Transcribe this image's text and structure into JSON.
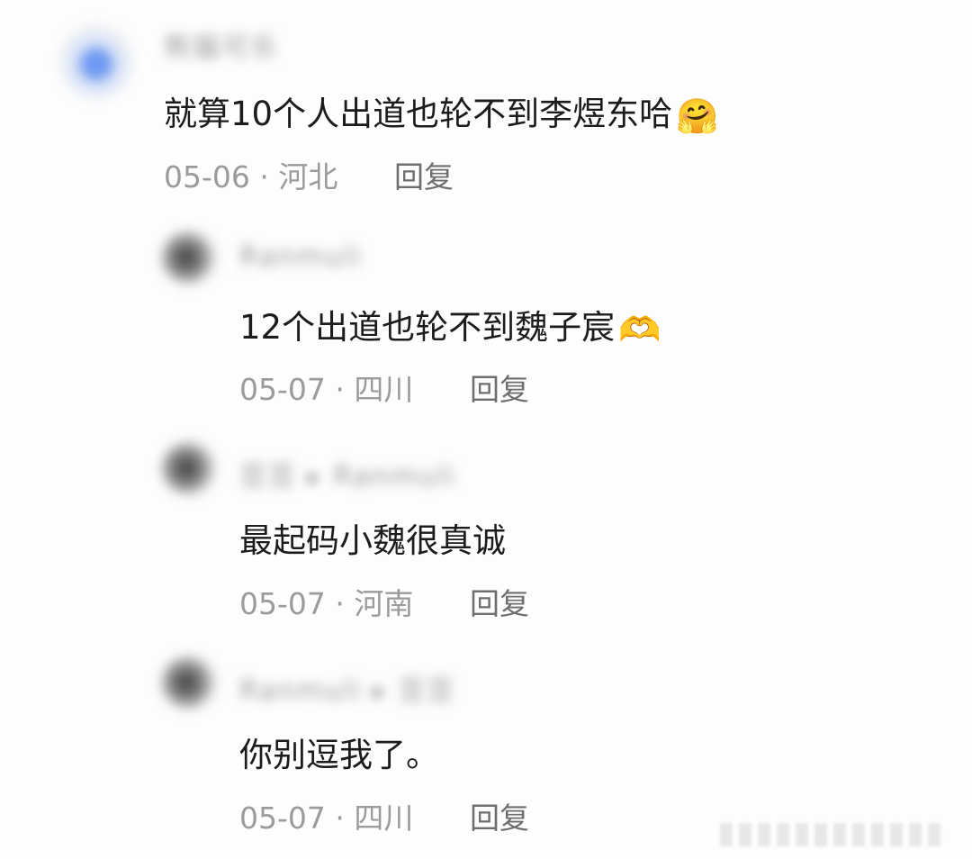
{
  "comments": [
    {
      "username": "熊猫可乐",
      "text": "就算10个人出道也轮不到李煜东哈",
      "emoji": "🤗",
      "date": "05-06",
      "location": "河北",
      "reply_label": "回复"
    },
    {
      "username": "Ranmuli",
      "text": "12个出道也轮不到魏子宸",
      "emoji": "🫶",
      "date": "05-07",
      "location": "四川",
      "reply_label": "回复"
    },
    {
      "username": "豆豆 ▸ Ranmuli",
      "text": "最起码小魏很真诚",
      "emoji": "",
      "date": "05-07",
      "location": "河南",
      "reply_label": "回复"
    },
    {
      "username": "Ranmuli ▸ 豆豆",
      "text": "你别逗我了。",
      "emoji": "",
      "date": "05-07",
      "location": "四川",
      "reply_label": "回复"
    }
  ],
  "separator": "·"
}
